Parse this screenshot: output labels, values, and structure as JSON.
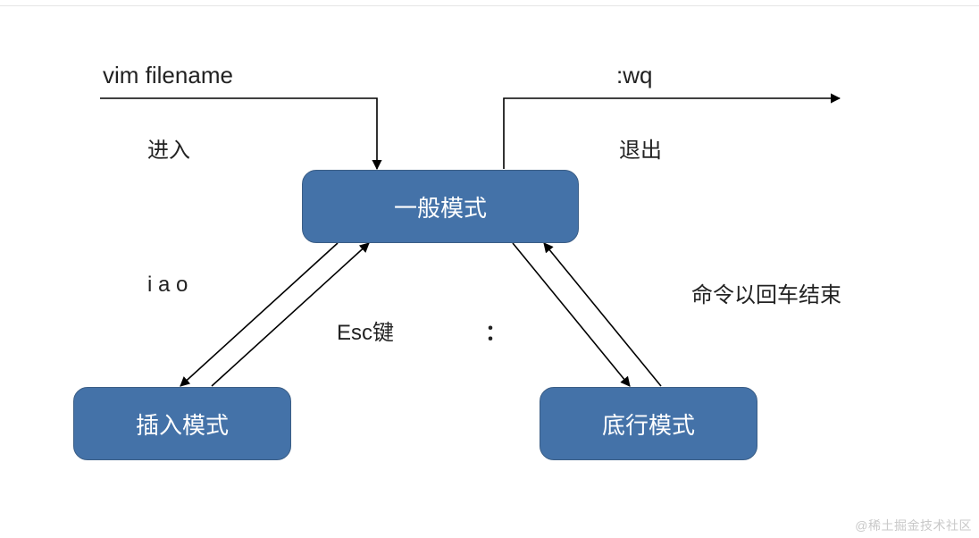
{
  "entry": {
    "command": "vim filename",
    "label": "进入"
  },
  "exit": {
    "command": ":wq",
    "label": "退出"
  },
  "nodes": {
    "normal": "一般模式",
    "insert": "插入模式",
    "command": "底行模式"
  },
  "edges": {
    "to_insert": "i a o",
    "from_insert": "Esc键",
    "to_command": "：",
    "from_command": "命令以回车结束"
  },
  "watermark": "@稀土掘金技术社区"
}
